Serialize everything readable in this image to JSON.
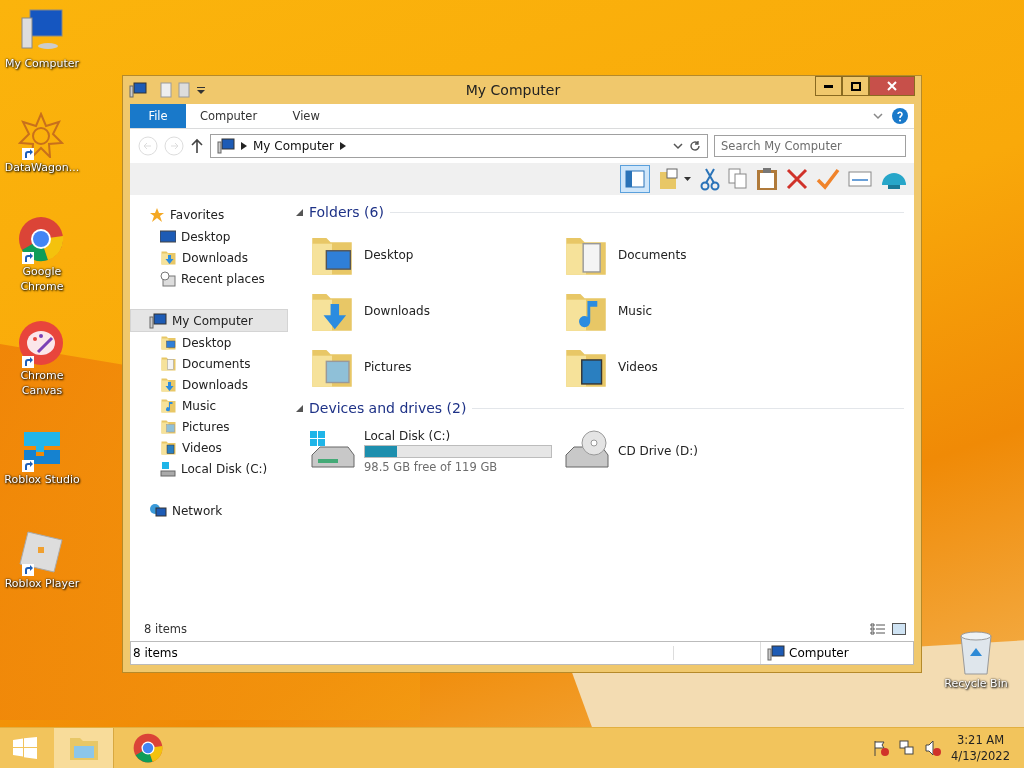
{
  "desktop_icons": [
    {
      "label": "My Computer",
      "kind": "computer",
      "shortcut": false
    },
    {
      "label": "DataWagon...",
      "kind": "star",
      "shortcut": true
    },
    {
      "label": "Google Chrome",
      "kind": "chrome",
      "shortcut": true
    },
    {
      "label": "Chrome Canvas",
      "kind": "canvas",
      "shortcut": true
    },
    {
      "label": "Roblox Studio",
      "kind": "studio",
      "shortcut": true
    },
    {
      "label": "Roblox Player",
      "kind": "player",
      "shortcut": true
    }
  ],
  "recycle_bin": {
    "label": "Recycle Bin"
  },
  "window": {
    "title": "My Computer",
    "ribbon_tabs": [
      {
        "label": "File",
        "kind": "file_menu"
      },
      {
        "label": "Computer",
        "kind": "tab"
      },
      {
        "label": "View",
        "kind": "tab"
      }
    ],
    "address": {
      "path": "My Computer"
    },
    "search": {
      "placeholder": "Search My Computer"
    },
    "nav_pane": [
      {
        "label": "Favorites",
        "kind": "star",
        "selected": false,
        "children": [
          {
            "label": "Desktop",
            "kind": "monitor"
          },
          {
            "label": "Downloads",
            "kind": "downloads"
          },
          {
            "label": "Recent places",
            "kind": "recent"
          }
        ]
      },
      {
        "label": "My Computer",
        "kind": "computer",
        "selected": true,
        "children": [
          {
            "label": "Desktop",
            "kind": "desktop"
          },
          {
            "label": "Documents",
            "kind": "documents"
          },
          {
            "label": "Downloads",
            "kind": "downloads"
          },
          {
            "label": "Music",
            "kind": "music"
          },
          {
            "label": "Pictures",
            "kind": "pictures"
          },
          {
            "label": "Videos",
            "kind": "videos"
          },
          {
            "label": "Local Disk (C:)",
            "kind": "disk"
          }
        ]
      },
      {
        "label": "Network",
        "kind": "network",
        "selected": false
      }
    ],
    "sections": [
      {
        "title": "Folders (6)",
        "kind": "folders",
        "items": [
          {
            "label": "Desktop",
            "kind": "desktop"
          },
          {
            "label": "Documents",
            "kind": "documents"
          },
          {
            "label": "Downloads",
            "kind": "downloads"
          },
          {
            "label": "Music",
            "kind": "music"
          },
          {
            "label": "Pictures",
            "kind": "pictures"
          },
          {
            "label": "Videos",
            "kind": "videos"
          }
        ]
      },
      {
        "title": "Devices and drives (2)",
        "kind": "drives",
        "items": [
          {
            "label": "Local Disk (C:)",
            "kind": "disk",
            "level": 0.17,
            "free": "98.5 GB free of 119 GB"
          },
          {
            "label": "CD Drive (D:)",
            "kind": "cd"
          }
        ]
      }
    ],
    "item_count": "8 items",
    "status_bar": {
      "left": "8 items",
      "right": "Computer"
    }
  },
  "taskbar": {
    "apps": [
      {
        "kind": "explorer",
        "selected": true
      },
      {
        "kind": "chrome",
        "selected": false
      }
    ],
    "time": "3:21 AM",
    "date": "4/13/2022"
  }
}
